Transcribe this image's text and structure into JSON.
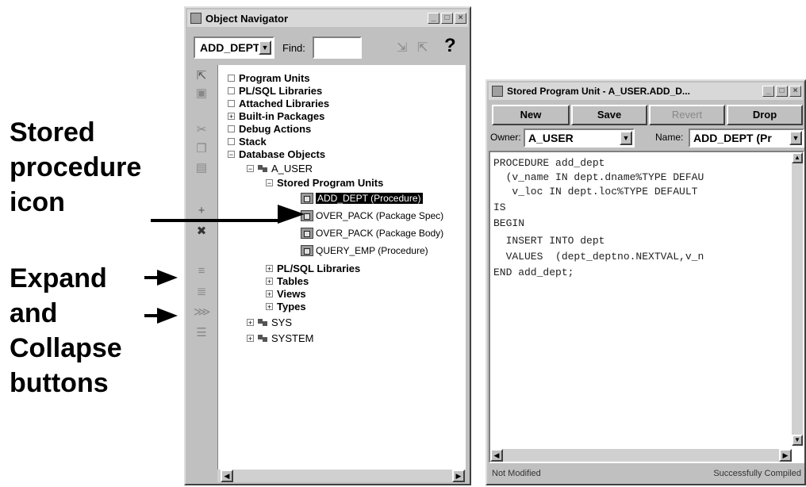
{
  "annotations": {
    "stored_1": "Stored",
    "stored_2": "procedure",
    "stored_3": "icon",
    "expand_1": "Expand",
    "expand_2": "and",
    "expand_3": "Collapse",
    "expand_4": "buttons"
  },
  "navigator": {
    "title": "Object Navigator",
    "context_value": "ADD_DEPT",
    "find_label": "Find:",
    "find_value": "",
    "help_glyph": "?",
    "tree": {
      "program_units": "Program Units",
      "plsql_libraries": "PL/SQL Libraries",
      "attached_libraries": "Attached Libraries",
      "builtin_packages": "Built-in Packages",
      "debug_actions": "Debug Actions",
      "stack": "Stack",
      "database_objects": "Database Objects",
      "a_user": "A_USER",
      "stored_program_units": "Stored Program Units",
      "items": [
        "ADD_DEPT (Procedure)",
        "OVER_PACK (Package Spec)",
        "OVER_PACK (Package Body)",
        "QUERY_EMP (Procedure)"
      ],
      "sub_plsql_libraries": "PL/SQL Libraries",
      "tables": "Tables",
      "views": "Views",
      "types": "Types",
      "sys": "SYS",
      "system": "SYSTEM"
    }
  },
  "editor": {
    "title": "Stored Program Unit - A_USER.ADD_D...",
    "buttons": {
      "new": "New",
      "save": "Save",
      "revert": "Revert",
      "drop": "Drop"
    },
    "owner_label": "Owner:",
    "owner_value": "A_USER",
    "name_label": "Name:",
    "name_value": "ADD_DEPT (Pr",
    "code": [
      "PROCEDURE add_dept",
      "  (v_name IN dept.dname%TYPE DEFAU",
      "   v_loc IN dept.loc%TYPE DEFAULT",
      "IS",
      "BEGIN",
      "  INSERT INTO dept",
      "  VALUES  (dept_deptno.NEXTVAL,v_n",
      "END add_dept;"
    ],
    "status_left": "Not Modified",
    "status_right": "Successfully Compiled"
  }
}
